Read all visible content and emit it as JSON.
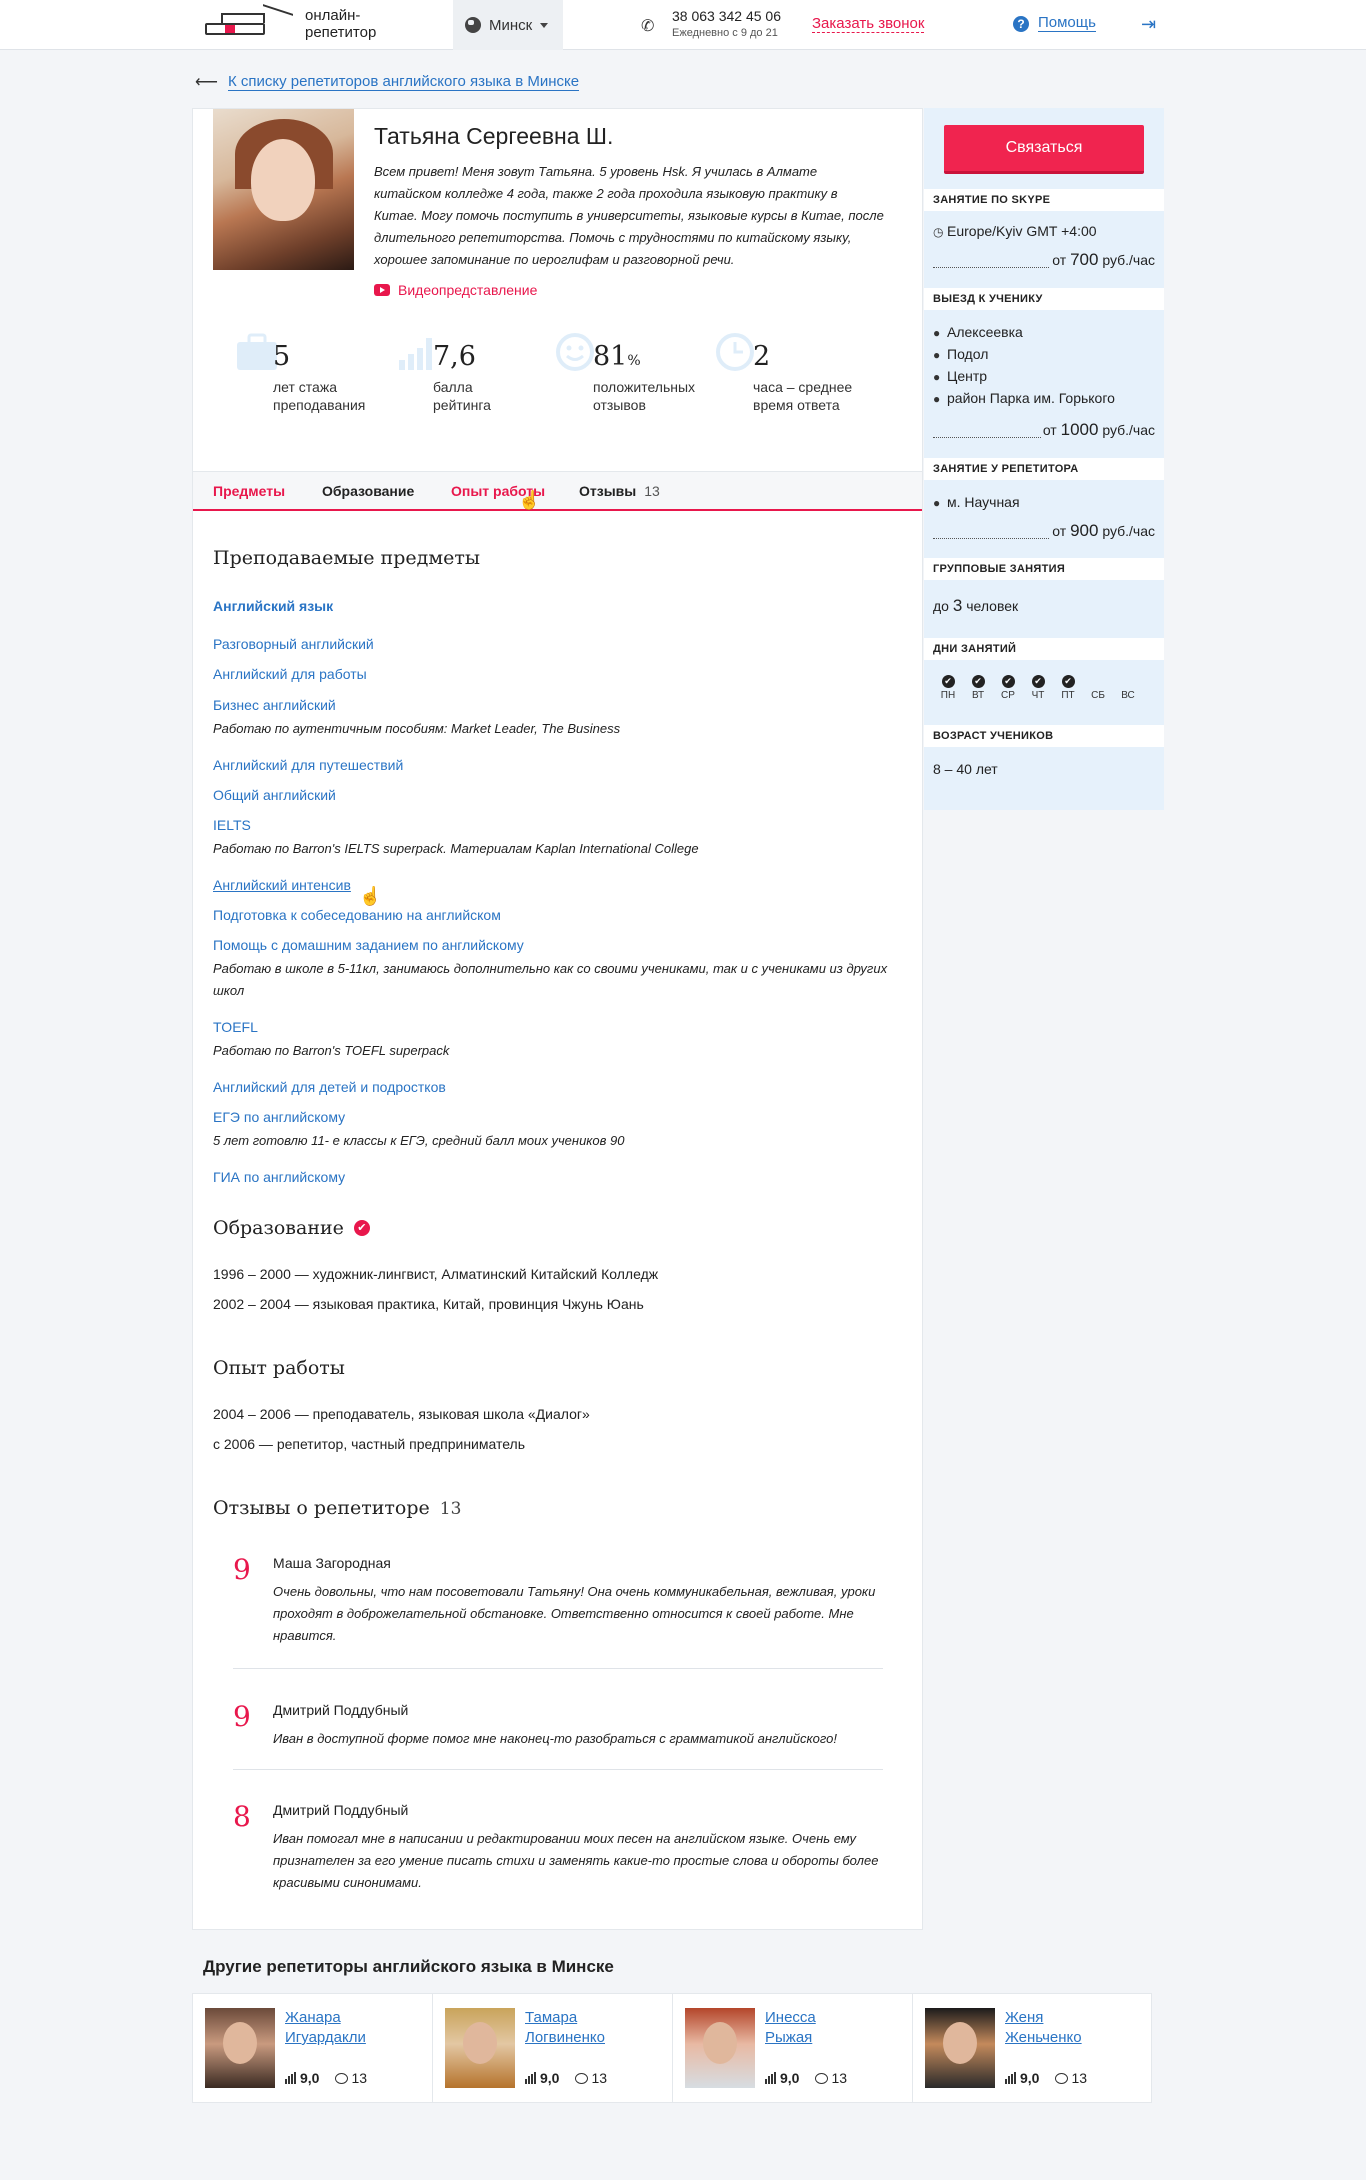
{
  "header": {
    "logo_text_1": "онлайн-",
    "logo_text_2": "репетитор",
    "city": "Минск",
    "phone": "38 063 342 45 06",
    "phone_hours": "Ежедневно с 9 до 21",
    "callback": "Заказать звонок",
    "help": "Помощь"
  },
  "back_link": "К списку репетиторов английского языка в Минске",
  "profile": {
    "name": "Татьяна Сергеевна Ш.",
    "bio": "Всем привет! Меня зовут Татьяна. 5 уровень Hsk. Я училась в Алмате китайском колледже 4 года, также 2 года проходила языковую практику в Китае. Могу помочь поступить в университеты, языковые курсы в Китае, после длительного репетиторства. Помочь с трудностями по китайскому языку, хорошее запоминание по иероглифам и разговорной речи.",
    "video": "Видеопредставление",
    "stats": [
      {
        "num": "5",
        "unit": "",
        "l1": "лет стажа",
        "l2": "преподавания"
      },
      {
        "num": "7,6",
        "unit": "",
        "l1": "балла",
        "l2": "рейтинга"
      },
      {
        "num": "81",
        "unit": "%",
        "l1": "положительных",
        "l2": "отзывов"
      },
      {
        "num": "2",
        "unit": "",
        "l1": "часа – среднее",
        "l2": "время ответа"
      }
    ]
  },
  "tabs": [
    {
      "label": "Предметы",
      "count": ""
    },
    {
      "label": "Образование",
      "count": ""
    },
    {
      "label": "Опыт работы",
      "count": ""
    },
    {
      "label": "Отзывы",
      "count": "13"
    }
  ],
  "subjects": {
    "title": "Преподаваемые предметы",
    "main": "Английский язык",
    "items": [
      {
        "label": "Разговорный английский",
        "note": ""
      },
      {
        "label": "Английский для работы",
        "note": ""
      },
      {
        "label": "Бизнес английский",
        "note": "Работаю по аутентичным пособиям: Market Leader, The Business"
      },
      {
        "label": "Английский для путешествий",
        "note": ""
      },
      {
        "label": "Общий английский",
        "note": ""
      },
      {
        "label": "IELTS",
        "note": "Работаю по Barron's IELTS superpack. Материалам Kaplan International College"
      },
      {
        "label": "Английский интенсив",
        "note": ""
      },
      {
        "label": "Подготовка к собеседованию на английском",
        "note": ""
      },
      {
        "label": "Помощь с домашним заданием по английскому",
        "note": "Работаю в школе в 5-11кл, занимаюсь дополнительно как со своими учениками, так и с учениками из других школ"
      },
      {
        "label": "TOEFL",
        "note": "Работаю по Barron's TOEFL superpack"
      },
      {
        "label": "Английский для детей и подростков",
        "note": ""
      },
      {
        "label": "ЕГЭ по английскому",
        "note": "5 лет готовлю 11- е классы к ЕГЭ, средний балл моих учеников 90"
      },
      {
        "label": "ГИА по английскому",
        "note": ""
      }
    ]
  },
  "education": {
    "title": "Образование",
    "items": [
      "1996 – 2000 — художник-лингвист, Алматинский Китайский Колледж",
      "2002 – 2004 — языковая практика, Китай, провинция Чжунь Юань"
    ]
  },
  "experience": {
    "title": "Опыт работы",
    "items": [
      "2004 – 2006 — преподаватель, языковая школа «Диалог»",
      "с 2006 — репетитор, частный предприниматель"
    ]
  },
  "reviews": {
    "title": "Отзывы о репетиторе",
    "count": "13",
    "items": [
      {
        "score": "9",
        "name": "Маша Загородная",
        "text": "Очень довольны, что нам посоветовали Татьяну! Она очень коммуникабельная, вежливая, уроки проходят в доброжелательной обстановке. Ответственно относится к своей работе. Мне нравится."
      },
      {
        "score": "9",
        "name": "Дмитрий Поддубный",
        "text": "Иван в доступной форме помог мне наконец-то разобраться с грамматикой английского!"
      },
      {
        "score": "8",
        "name": "Дмитрий Поддубный",
        "text": "Иван помогал мне в написании и редактировании моих песен на английском языке. Очень ему признателен за его умение писать стихи и заменять какие-то простые слова и обороты более красивыми синонимами."
      }
    ]
  },
  "sidebar": {
    "contact_button": "Связаться",
    "skype": {
      "title": "ЗАНЯТИЕ ПО SKYPE",
      "timezone": "Europe/Kyiv GMT +4:00",
      "price_prefix": "от",
      "price": "700",
      "price_unit": "руб./час"
    },
    "visit": {
      "title": "ВЫЕЗД К УЧЕНИКУ",
      "places": [
        "Алексеевка",
        "Подол",
        "Центр",
        "район Парка им. Горького"
      ],
      "price_prefix": "от",
      "price": "1000",
      "price_unit": "руб./час"
    },
    "at_tutor": {
      "title": "ЗАНЯТИЕ У РЕПЕТИТОРА",
      "place": "м. Научная",
      "price_prefix": "от",
      "price": "900",
      "price_unit": "руб./час"
    },
    "group": {
      "title": "ГРУППОВЫЕ ЗАНЯТИЯ",
      "prefix": "до",
      "num": "3",
      "suffix": "человек"
    },
    "days": {
      "title": "ДНИ ЗАНЯТИЙ",
      "items": [
        {
          "label": "ПН",
          "active": true
        },
        {
          "label": "ВТ",
          "active": true
        },
        {
          "label": "СР",
          "active": true
        },
        {
          "label": "ЧТ",
          "active": true
        },
        {
          "label": "ПТ",
          "active": true
        },
        {
          "label": "СБ",
          "active": false
        },
        {
          "label": "ВС",
          "active": false
        }
      ]
    },
    "age": {
      "title": "ВОЗРАСТ УЧЕНИКОВ",
      "value": "8 – 40 лет"
    }
  },
  "others": {
    "title": "Другие репетиторы английского языка в Минске",
    "items": [
      {
        "first": "Жанара",
        "last": "Игуардакли",
        "rating": "9,0",
        "reviews": "13"
      },
      {
        "first": "Тамара",
        "last": "Логвиненко",
        "rating": "9,0",
        "reviews": "13"
      },
      {
        "first": "Инесса",
        "last": "Рыжая",
        "rating": "9,0",
        "reviews": "13"
      },
      {
        "first": "Женя",
        "last": "Женьченко",
        "rating": "9,0",
        "reviews": "13"
      }
    ]
  },
  "icons": {
    "phone": "phone-icon",
    "help": "question-icon",
    "login": "login-icon",
    "globe": "globe-icon",
    "video": "youtube-icon",
    "check": "check-icon",
    "pin": "map-pin-icon",
    "clock": "clock-icon"
  },
  "colors": {
    "accent": "#e8174c",
    "link": "#2a74c4",
    "sidebar_bg": "#e6f1fb"
  }
}
